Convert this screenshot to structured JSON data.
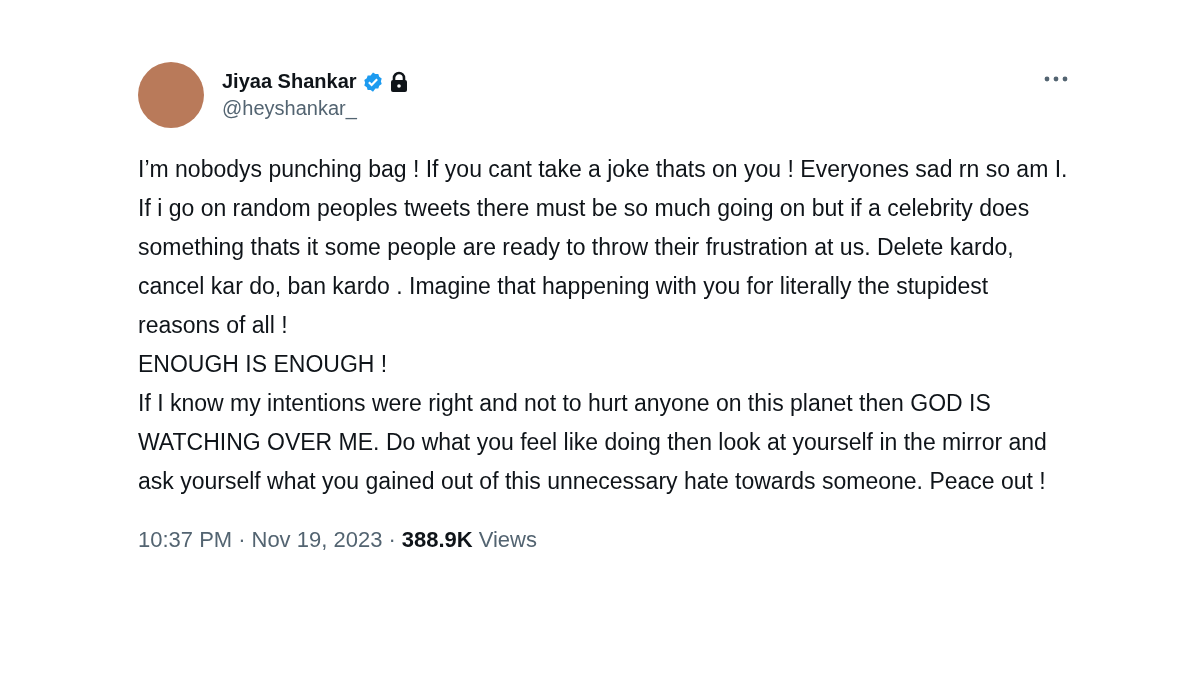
{
  "author": {
    "name": "Jiyaa Shankar",
    "handle": "@heyshankar_",
    "verified": true,
    "protected": true
  },
  "body": [
    "I’m nobodys punching bag ! If you cant take a joke thats on you ! Everyones sad rn so am I. If i go on random peoples tweets there must be so much going on but if a celebrity does something thats it some people are ready to throw their frustration at us. Delete kardo, cancel kar do, ban kardo . Imagine that happening with you for literally the stupidest reasons of all !",
    "ENOUGH IS ENOUGH !",
    "If I know my intentions were right and not to hurt anyone on this planet then GOD IS WATCHING OVER ME. Do what you feel like doing then look at yourself in the mirror and ask yourself what you gained out of this unnecessary hate towards someone. Peace out !"
  ],
  "meta": {
    "time": "10:37 PM",
    "separators": [
      "·",
      "·"
    ],
    "date": "Nov 19, 2023",
    "views_count": "388.9K",
    "views_label": "Views"
  }
}
